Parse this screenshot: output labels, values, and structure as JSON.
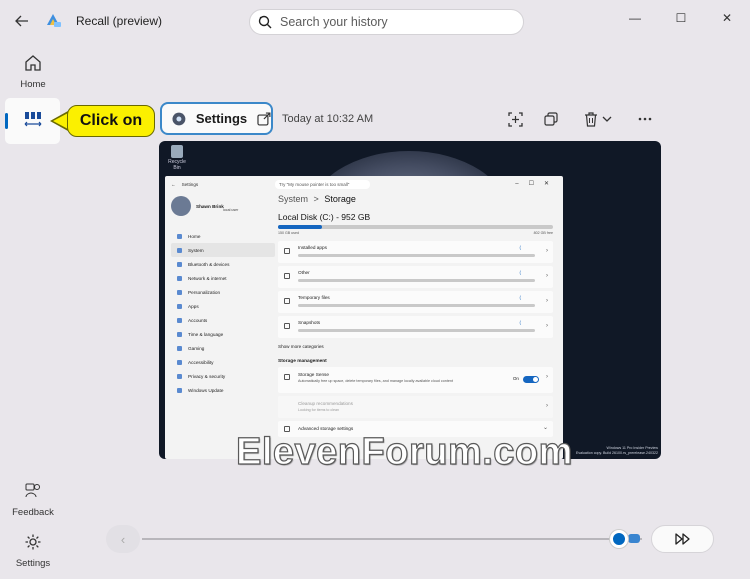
{
  "window": {
    "title": "Recall (preview)",
    "app_icon": "recall-app-icon",
    "controls": {
      "minimize": "—",
      "maximize": "☐",
      "close": "✕"
    }
  },
  "search": {
    "placeholder": "Search your history",
    "value": ""
  },
  "rail": {
    "home_label": "Home",
    "timeline_label": "",
    "feedback_label": "Feedback",
    "settings_label": "Settings"
  },
  "callout": {
    "text": "Click on"
  },
  "snapshot_header": {
    "app_name": "Settings",
    "timestamp": "Today at 10:32 AM"
  },
  "snapshot": {
    "desktop_icon_label": "Recycle Bin",
    "settings_window": {
      "title": "Settings",
      "search_text": "Try \"My mouse pointer is too small\"",
      "user_name": "Shawn Brink",
      "user_account": "local user",
      "nav": [
        {
          "label": "Home",
          "selected": false
        },
        {
          "label": "System",
          "selected": true
        },
        {
          "label": "Bluetooth & devices",
          "selected": false
        },
        {
          "label": "Network & internet",
          "selected": false
        },
        {
          "label": "Personalization",
          "selected": false
        },
        {
          "label": "Apps",
          "selected": false
        },
        {
          "label": "Accounts",
          "selected": false
        },
        {
          "label": "Time & language",
          "selected": false
        },
        {
          "label": "Gaming",
          "selected": false
        },
        {
          "label": "Accessibility",
          "selected": false
        },
        {
          "label": "Privacy & security",
          "selected": false
        },
        {
          "label": "Windows Update",
          "selected": false
        }
      ],
      "breadcrumb_parent": "System",
      "breadcrumb_sep": ">",
      "breadcrumb_current": "Storage",
      "disk_title": "Local Disk (C:) - 952 GB",
      "disk_used": "150 GB used",
      "disk_free": "802 GB free",
      "disk_used_fraction": 0.16,
      "categories": [
        {
          "label": "Installed apps"
        },
        {
          "label": "Other"
        },
        {
          "label": "Temporary files"
        },
        {
          "label": "Snapshots"
        }
      ],
      "show_more": "Show more categories",
      "section_title": "Storage management",
      "storage_sense_title": "Storage Sense",
      "storage_sense_desc": "Automatically free up space, delete temporary files, and manage locally available cloud content",
      "storage_sense_state": "On",
      "cleanup_title": "Cleanup recommendations",
      "cleanup_desc": "Looking for items to clean",
      "advanced_title": "Advanced storage settings"
    },
    "build_line1": "Windows 11 Pro Insider Preview",
    "build_line2": "Evaluation copy. Build 26100.rs_prerelease.240322"
  },
  "watermark": "ElevenForum.com",
  "timeline": {
    "position_fraction": 0.95
  },
  "colors": {
    "accent": "#0067c0",
    "callout": "#fbf000",
    "chip_border": "#3b88c9"
  }
}
